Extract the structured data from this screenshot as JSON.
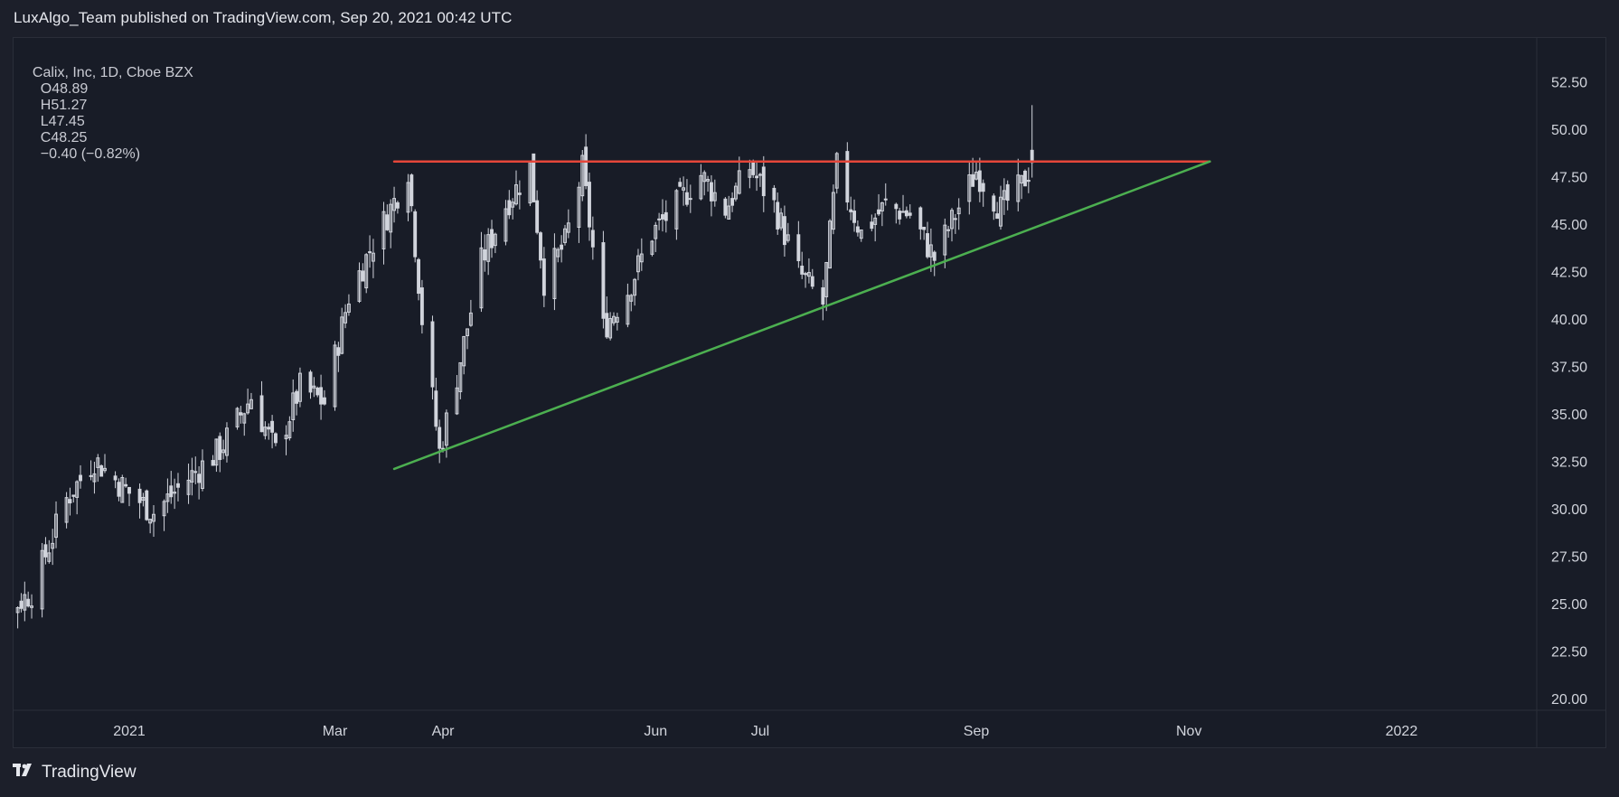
{
  "header": {
    "publish_line": "LuxAlgo_Team published on TradingView.com, Sep 20, 2021 00:42 UTC"
  },
  "legend": {
    "symbol": "Calix, Inc, 1D, Cboe BZX",
    "open": "O48.89",
    "high": "H51.27",
    "low": "L47.45",
    "close": "C48.25",
    "change": "−0.40 (−0.82%)"
  },
  "footer": {
    "brand": "TradingView",
    "logo_icon": "tradingview-logo-icon"
  },
  "colors": {
    "background": "#181c27",
    "resistance": "#e5463a",
    "support": "#4caf50",
    "candle": "#d1d4dc"
  },
  "chart_data": {
    "type": "candlestick",
    "y_axis": {
      "ylim": [
        20,
        54
      ],
      "ticks": [
        "52.50",
        "50.00",
        "47.50",
        "45.00",
        "42.50",
        "40.00",
        "37.50",
        "35.00",
        "32.50",
        "30.00",
        "27.50",
        "25.00",
        "22.50",
        "20.00"
      ],
      "tick_values": [
        52.5,
        50,
        47.5,
        45,
        42.5,
        40,
        37.5,
        35,
        32.5,
        30,
        27.5,
        25,
        22.5,
        20
      ]
    },
    "x_axis": {
      "xlim": [
        "2020-11-16",
        "2022-02-10"
      ],
      "tick_labels": [
        "2021",
        "Mar",
        "Apr",
        "Jun",
        "Jul",
        "Sep",
        "Nov",
        "2022"
      ],
      "tick_dates": [
        "2021-01-01",
        "2021-03-01",
        "2021-04-01",
        "2021-06-01",
        "2021-07-01",
        "2021-09-01",
        "2021-11-01",
        "2022-01-01"
      ]
    },
    "series": [
      {
        "kind": "ohlc_close_path",
        "closes": [
          [
            "2020-11-16",
            23.8
          ],
          [
            "2020-11-25",
            24.3
          ],
          [
            "2020-12-04",
            25.6
          ],
          [
            "2020-12-14",
            30.5
          ],
          [
            "2020-12-22",
            32.6
          ],
          [
            "2020-12-31",
            31.0
          ],
          [
            "2021-01-08",
            29.8
          ],
          [
            "2021-01-18",
            31.6
          ],
          [
            "2021-01-27",
            33.1
          ],
          [
            "2021-02-05",
            35.9
          ],
          [
            "2021-02-12",
            33.0
          ],
          [
            "2021-02-19",
            36.4
          ],
          [
            "2021-02-26",
            35.6
          ],
          [
            "2021-03-05",
            41.2
          ],
          [
            "2021-03-12",
            44.0
          ],
          [
            "2021-03-18",
            46.2
          ],
          [
            "2021-03-22",
            47.9
          ],
          [
            "2021-03-26",
            40.0
          ],
          [
            "2021-03-31",
            33.0
          ],
          [
            "2021-04-05",
            37.0
          ],
          [
            "2021-04-12",
            43.0
          ],
          [
            "2021-04-19",
            46.0
          ],
          [
            "2021-04-26",
            48.0
          ],
          [
            "2021-04-30",
            42.0
          ],
          [
            "2021-05-06",
            44.0
          ],
          [
            "2021-05-11",
            47.9
          ],
          [
            "2021-05-17",
            39.5
          ],
          [
            "2021-05-24",
            41.5
          ],
          [
            "2021-05-31",
            44.5
          ],
          [
            "2021-06-07",
            46.0
          ],
          [
            "2021-06-14",
            47.6
          ],
          [
            "2021-06-21",
            45.8
          ],
          [
            "2021-06-28",
            48.0
          ],
          [
            "2021-07-05",
            46.0
          ],
          [
            "2021-07-12",
            42.5
          ],
          [
            "2021-07-19",
            40.8
          ],
          [
            "2021-07-23",
            48.0
          ],
          [
            "2021-07-30",
            44.5
          ],
          [
            "2021-08-06",
            46.0
          ],
          [
            "2021-08-13",
            45.5
          ],
          [
            "2021-08-20",
            43.2
          ],
          [
            "2021-08-26",
            45.5
          ],
          [
            "2021-09-01",
            47.8
          ],
          [
            "2021-09-08",
            45.8
          ],
          [
            "2021-09-14",
            47.0
          ],
          [
            "2021-09-17",
            48.25
          ]
        ],
        "last_open": 48.89,
        "last_high": 51.27,
        "last_low": 47.45,
        "last_close": 48.25
      }
    ],
    "lines": [
      {
        "name": "",
        "role": "resistance",
        "from": [
          "2021-03-18",
          48.3
        ],
        "to": [
          "2021-11-07",
          48.3
        ]
      },
      {
        "name": "",
        "role": "support",
        "from": [
          "2021-03-18",
          32.1
        ],
        "to": [
          "2021-11-07",
          48.3
        ]
      }
    ],
    "title": "",
    "xlabel": "",
    "ylabel": "",
    "grid": false
  }
}
